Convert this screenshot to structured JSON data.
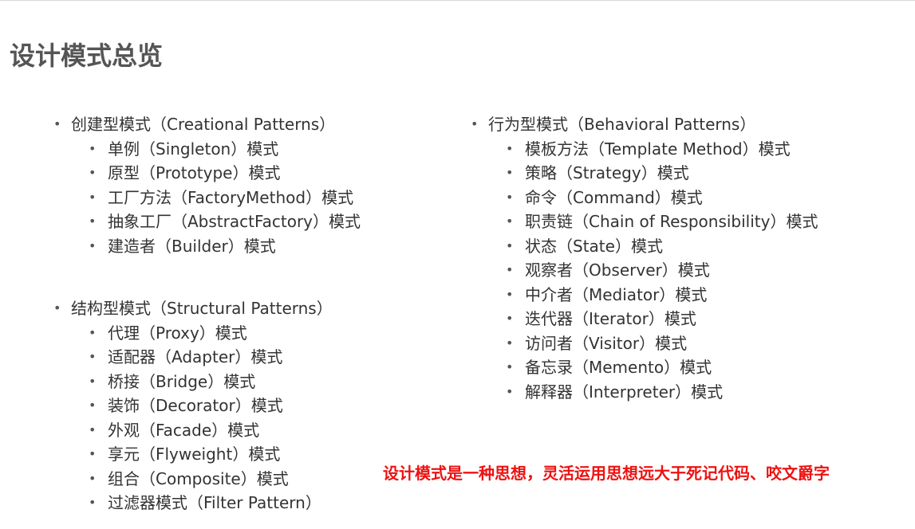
{
  "title": "设计模式总览",
  "left_column": [
    {
      "label": "创建型模式（Creational Patterns）",
      "items": [
        "单例（Singleton）模式",
        "原型（Prototype）模式",
        "工厂方法（FactoryMethod）模式",
        "抽象工厂（AbstractFactory）模式",
        "建造者（Builder）模式"
      ]
    },
    {
      "label": "结构型模式（Structural Patterns）",
      "items": [
        "代理（Proxy）模式",
        "适配器（Adapter）模式",
        "桥接（Bridge）模式",
        "装饰（Decorator）模式",
        "外观（Facade）模式",
        "享元（Flyweight）模式",
        "组合（Composite）模式",
        "过滤器模式（Filter Pattern）"
      ]
    }
  ],
  "right_column": [
    {
      "label": "行为型模式（Behavioral Patterns）",
      "items": [
        "模板方法（Template Method）模式",
        "策略（Strategy）模式",
        "命令（Command）模式",
        "职责链（Chain of Responsibility）模式",
        "状态（State）模式",
        "观察者（Observer）模式",
        "中介者（Mediator）模式",
        "迭代器（Iterator）模式",
        "访问者（Visitor）模式",
        "备忘录（Memento）模式",
        "解释器（Interpreter）模式"
      ]
    }
  ],
  "note": "设计模式是一种思想，灵活运用思想远大于死记代码、咬文爵字",
  "colors": {
    "title": "#555555",
    "text": "#333333",
    "note": "#ee1111"
  },
  "bullet_glyph": "•"
}
